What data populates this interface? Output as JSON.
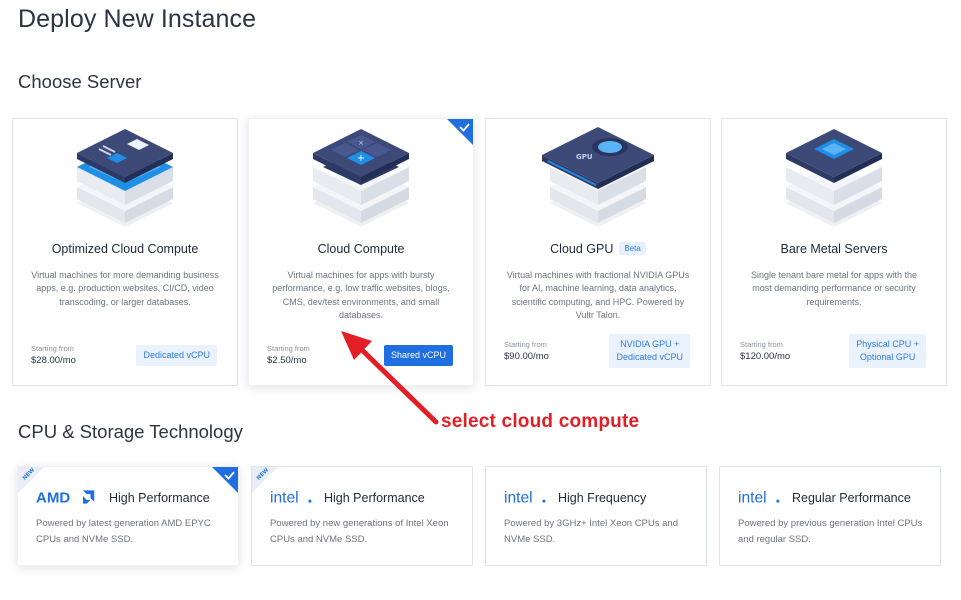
{
  "page": {
    "title": "Deploy New Instance"
  },
  "sections": {
    "server": "Choose Server",
    "cpu": "CPU & Storage Technology"
  },
  "server_cards": [
    {
      "name": "Optimized Cloud Compute",
      "desc": "Virtual machines for more demanding business apps, e.g. production websites, CI/CD, video transcoding, or larger databases.",
      "starting_label": "Starting from",
      "price": "$28.00/mo",
      "tag": "Dedicated vCPU",
      "selected": false
    },
    {
      "name": "Cloud Compute",
      "desc": "Virtual machines for apps with bursty performance, e.g. low traffic websites, blogs, CMS, dev/test environments, and small databases.",
      "starting_label": "Starting from",
      "price": "$2.50/mo",
      "tag": "Shared vCPU",
      "selected": true
    },
    {
      "name": "Cloud GPU",
      "badge": "Beta",
      "desc": "Virtual machines with fractional NVIDIA GPUs for AI, machine learning, data analytics, scientific computing, and HPC. Powered by Vultr Talon.",
      "starting_label": "Starting from",
      "price": "$90.00/mo",
      "tag_line1": "NVIDIA GPU +",
      "tag_line2": "Dedicated vCPU",
      "selected": false
    },
    {
      "name": "Bare Metal Servers",
      "desc": "Single tenant bare metal for apps with the most demanding performance or security requirements.",
      "starting_label": "Starting from",
      "price": "$120.00/mo",
      "tag_line1": "Physical CPU +",
      "tag_line2": "Optional GPU",
      "selected": false
    }
  ],
  "cpu_cards": [
    {
      "brand": "AMD",
      "perf": "High Performance",
      "desc": "Powered by latest generation AMD EPYC CPUs and NVMe SSD.",
      "new_badge": "NEW",
      "selected": true
    },
    {
      "brand": "intel",
      "perf": "High Performance",
      "desc": "Powered by new generations of Intel Xeon CPUs and NVMe SSD.",
      "new_badge": "NEW",
      "selected": false
    },
    {
      "brand": "intel",
      "perf": "High Frequency",
      "desc": "Powered by 3GHz+ Intel Xeon CPUs and NVMe SSD.",
      "selected": false
    },
    {
      "brand": "intel",
      "perf": "Regular Performance",
      "desc": "Powered by previous generation Intel CPUs and regular SSD.",
      "selected": false
    }
  ],
  "annotation": {
    "text": "select cloud compute",
    "color": "#e41e25"
  },
  "colors": {
    "accent": "#1f6fe0",
    "tag_bg": "#eaf2fd",
    "tag_text": "#2f7be4",
    "card_border": "#dfe3ea",
    "server_dark": "#3d4a78",
    "server_blue": "#1e8ee6"
  },
  "icons": [
    "checkmark-icon",
    "server-illustration",
    "amd-logo",
    "intel-logo",
    "arrow-annotation"
  ]
}
